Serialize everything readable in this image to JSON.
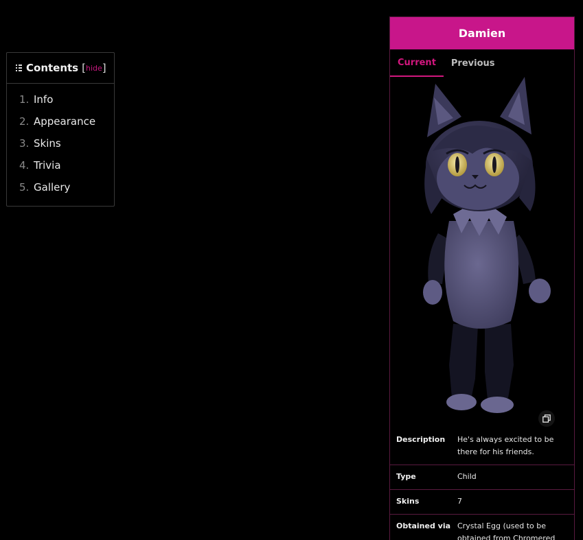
{
  "toc": {
    "title": "Contents",
    "bracket_open": "[",
    "hide_label": "hide",
    "bracket_close": "]",
    "items": [
      {
        "num": "1.",
        "label": "Info"
      },
      {
        "num": "2.",
        "label": "Appearance"
      },
      {
        "num": "3.",
        "label": "Skins"
      },
      {
        "num": "4.",
        "label": "Trivia"
      },
      {
        "num": "5.",
        "label": "Gallery"
      }
    ]
  },
  "infobox": {
    "title": "Damien",
    "tabs": [
      {
        "label": "Current",
        "active": true
      },
      {
        "label": "Previous",
        "active": false
      }
    ],
    "rows": [
      {
        "key": "Description",
        "value": "He's always excited to be there for his friends."
      },
      {
        "key": "Type",
        "value": "Child"
      },
      {
        "key": "Skins",
        "value": "7"
      },
      {
        "key": "Obtained via",
        "value": "Crystal Egg (used to be obtained from Chromered"
      }
    ]
  },
  "colors": {
    "accent": "#c8168a",
    "tab_active": "#d3177f",
    "border": "#5a1a40",
    "background": "#000000"
  }
}
